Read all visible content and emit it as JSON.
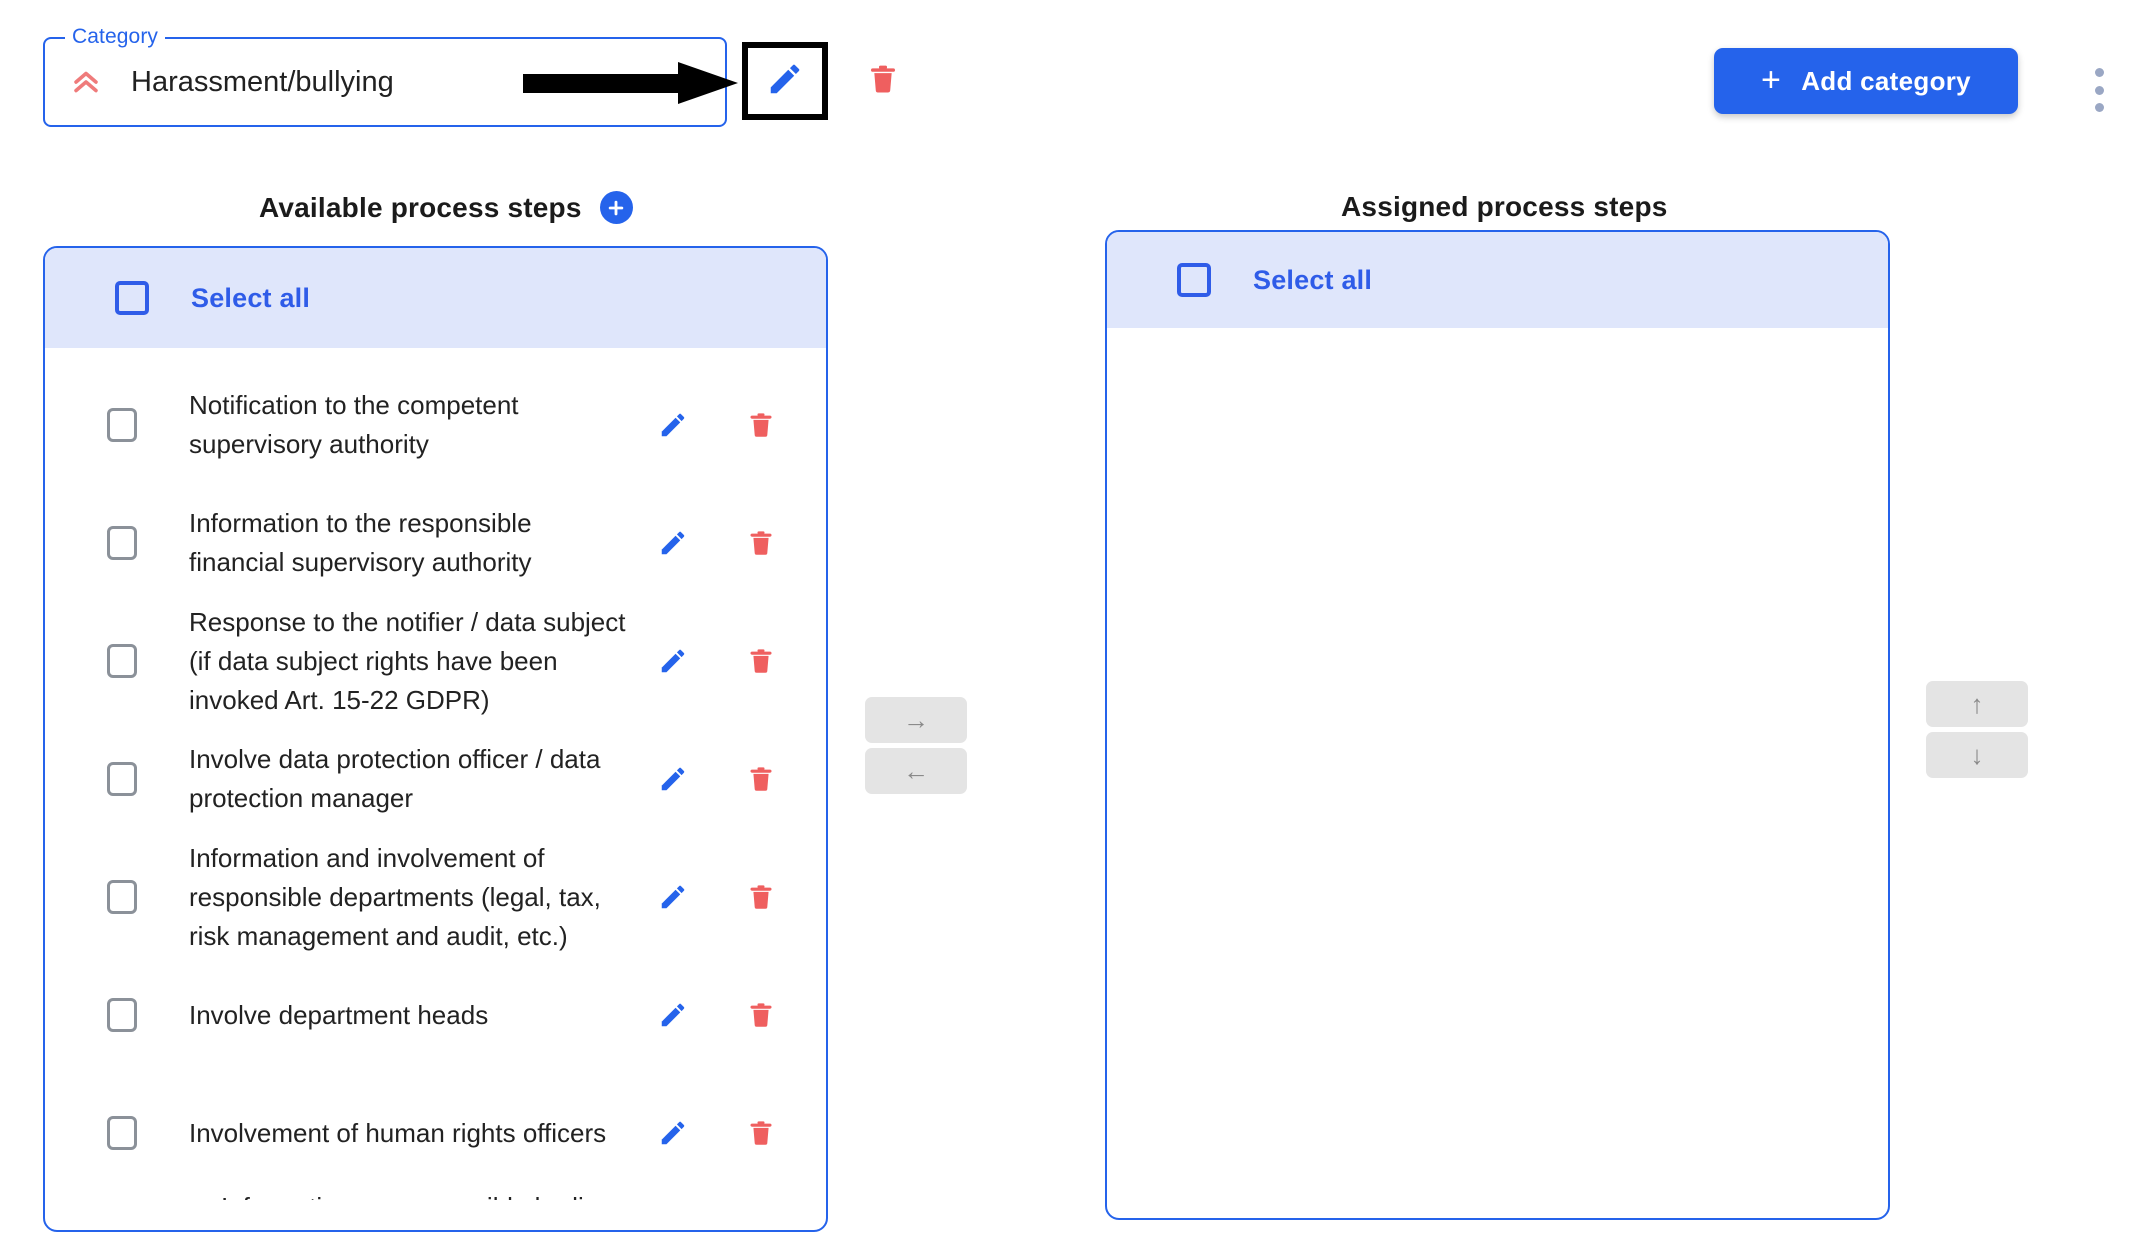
{
  "colors": {
    "accent_blue": "#2563eb",
    "header_fill": "#dfe6fb",
    "danger_red": "#ef5f5f",
    "chevron_red": "#ef7b7b",
    "muted_gray": "#8a8a8a",
    "kebab_gray": "#9aa7c4"
  },
  "topbar": {
    "category_legend": "Category",
    "category_value": "Harassment/bullying",
    "category_icon": "double-chevron-up-icon",
    "edit_icon": "pencil-icon",
    "delete_icon": "trash-icon",
    "add_category_plus": "+",
    "add_category_label": "Add category",
    "overflow_icon": "kebab-menu-icon"
  },
  "available": {
    "heading": "Available process steps",
    "add_icon": "plus-circle-icon",
    "select_all_label": "Select all",
    "steps": [
      {
        "text": "Notification to the competent supervisory authority"
      },
      {
        "text": "Information to the responsible financial supervisory authority"
      },
      {
        "text": "Response to the notifier / data subject (if data subject rights have been invoked Art. 15-22 GDPR)"
      },
      {
        "text": "Involve data protection officer / data protection manager"
      },
      {
        "text": "Information and involvement of responsible departments (legal, tax, risk management and audit, etc.)"
      },
      {
        "text": "Involve department heads"
      },
      {
        "text": "Involvement of human rights officers"
      }
    ],
    "clipped_step": "Information on responsible bodies"
  },
  "assigned": {
    "heading": "Assigned process steps",
    "select_all_label": "Select all",
    "steps": []
  },
  "transfer": {
    "move_right": "→",
    "move_left": "←",
    "move_up": "↑",
    "move_down": "↓"
  }
}
